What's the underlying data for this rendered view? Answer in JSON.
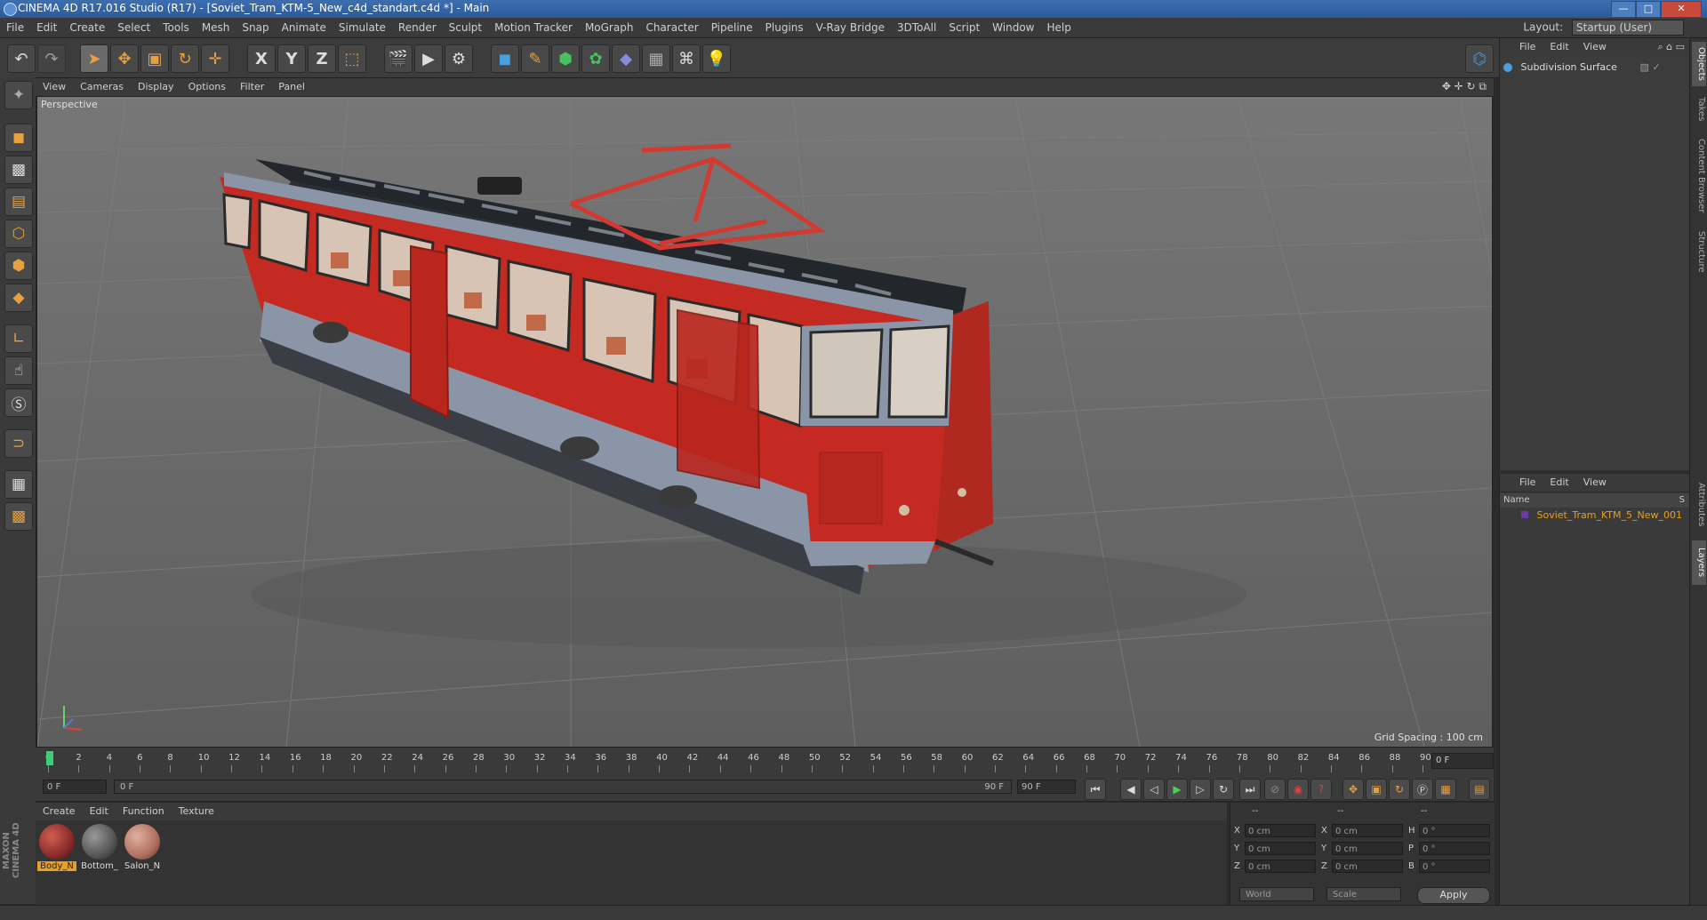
{
  "window": {
    "title": "CINEMA 4D R17.016 Studio (R17) - [Soviet_Tram_KTM-5_New_c4d_standart.c4d *] - Main",
    "minimize": "—",
    "maximize": "□",
    "close": "✕"
  },
  "menubar": {
    "items": [
      "File",
      "Edit",
      "Create",
      "Select",
      "Tools",
      "Mesh",
      "Snap",
      "Animate",
      "Simulate",
      "Render",
      "Sculpt",
      "Motion Tracker",
      "MoGraph",
      "Character",
      "Pipeline",
      "Plugins",
      "V-Ray Bridge",
      "3DToAll",
      "Script",
      "Window",
      "Help"
    ],
    "layout_label": "Layout:",
    "layout_value": "Startup (User)"
  },
  "toolbar": {
    "icons": [
      "undo-icon",
      "redo-icon",
      "select-arrow-icon",
      "move-icon",
      "scale-icon",
      "rotate-icon",
      "live-select-icon",
      "x-axis-icon",
      "y-axis-icon",
      "z-axis-icon",
      "coordinate-system-icon",
      "render-view-icon",
      "render-picture-viewer-icon",
      "edit-render-settings-icon",
      "cube-icon",
      "pen-icon",
      "subdivision-icon",
      "array-icon",
      "deformer-icon",
      "floor-icon",
      "camera-icon",
      "light-icon",
      "python-icon"
    ],
    "x_label": "X",
    "y_label": "Y",
    "z_label": "Z"
  },
  "viewport": {
    "menu": [
      "View",
      "Cameras",
      "Display",
      "Options",
      "Filter",
      "Panel"
    ],
    "label": "Perspective",
    "grid_spacing": "Grid Spacing : 100 cm"
  },
  "timeline": {
    "ticks": [
      "0",
      "2",
      "4",
      "6",
      "8",
      "10",
      "12",
      "14",
      "16",
      "18",
      "20",
      "22",
      "24",
      "26",
      "28",
      "30",
      "32",
      "34",
      "36",
      "38",
      "40",
      "42",
      "44",
      "46",
      "48",
      "50",
      "52",
      "54",
      "56",
      "58",
      "60",
      "62",
      "64",
      "66",
      "68",
      "70",
      "72",
      "74",
      "76",
      "78",
      "80",
      "82",
      "84",
      "86",
      "88",
      "90"
    ],
    "current_frame": "0 F"
  },
  "transport": {
    "start_field": "0 F",
    "range_start": "0 F",
    "range_end": "90 F",
    "end_field": "90 F"
  },
  "material_panel": {
    "menu": [
      "Create",
      "Edit",
      "Function",
      "Texture"
    ],
    "materials": [
      {
        "name": "Body_N",
        "color": "#8a2a2a"
      },
      {
        "name": "Bottom_",
        "color": "#555555"
      },
      {
        "name": "Salon_N",
        "color": "#b07060"
      }
    ]
  },
  "coordinates": {
    "headers": [
      "--",
      "--",
      "--"
    ],
    "rows": [
      {
        "a_label": "X",
        "a_val": "0 cm",
        "b_label": "X",
        "b_val": "0 cm",
        "c_label": "H",
        "c_val": "0 °"
      },
      {
        "a_label": "Y",
        "a_val": "0 cm",
        "b_label": "Y",
        "b_val": "0 cm",
        "c_label": "P",
        "c_val": "0 °"
      },
      {
        "a_label": "Z",
        "a_val": "0 cm",
        "b_label": "Z",
        "b_val": "0 cm",
        "c_label": "B",
        "c_val": "0 °"
      }
    ],
    "world_dropdown": "World",
    "scale_dropdown": "Scale",
    "apply_label": "Apply"
  },
  "object_manager": {
    "menu": [
      "File",
      "Edit",
      "View"
    ],
    "objects": [
      {
        "name": "Subdivision Surface"
      }
    ]
  },
  "layer_manager": {
    "menu": [
      "File",
      "Edit",
      "View"
    ],
    "column_name": "Name",
    "column_s": "S",
    "layers": [
      {
        "name": "Soviet_Tram_KTM_5_New_001"
      }
    ]
  },
  "right_tabs": [
    "Objects",
    "Takes",
    "Content Browser",
    "Structure",
    "Attributes",
    "Layers"
  ],
  "brand": "MAXON CINEMA 4D"
}
